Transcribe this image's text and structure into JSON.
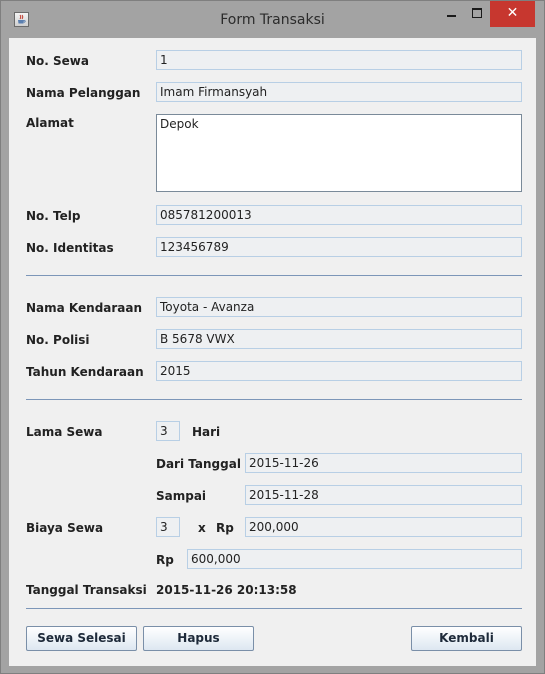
{
  "window": {
    "title": "Form Transaksi",
    "close_glyph": "✕"
  },
  "form": {
    "no_sewa": {
      "label": "No. Sewa",
      "value": "1"
    },
    "nama_pelanggan": {
      "label": "Nama Pelanggan",
      "value": "Imam Firmansyah"
    },
    "alamat": {
      "label": "Alamat",
      "value": "Depok"
    },
    "no_telp": {
      "label": "No. Telp",
      "value": "085781200013"
    },
    "no_identitas": {
      "label": "No. Identitas",
      "value": "123456789"
    },
    "nama_kendaraan": {
      "label": "Nama Kendaraan",
      "value": "Toyota - Avanza"
    },
    "no_polisi": {
      "label": "No. Polisi",
      "value": "B 5678 VWX"
    },
    "tahun_kendaraan": {
      "label": "Tahun Kendaraan",
      "value": "2015"
    },
    "lama_sewa": {
      "label": "Lama Sewa",
      "value": "3",
      "unit": "Hari"
    },
    "dari_tanggal": {
      "label": "Dari Tanggal",
      "value": "2015-11-26"
    },
    "sampai": {
      "label": "Sampai",
      "value": "2015-11-28"
    },
    "biaya_sewa": {
      "label": "Biaya Sewa",
      "qty": "3",
      "times": "x",
      "currency": "Rp",
      "price": "200,000"
    },
    "total": {
      "currency": "Rp",
      "value": "600,000"
    },
    "tanggal_transaksi": {
      "label": "Tanggal Transaksi",
      "value": "2015-11-26 20:13:58"
    }
  },
  "buttons": {
    "sewa_selesai": "Sewa Selesai",
    "hapus": "Hapus",
    "kembali": "Kembali"
  },
  "icons": {
    "app": "java-cup-icon",
    "minimize": "minimize-icon",
    "maximize": "maximize-icon",
    "close": "close-icon"
  }
}
